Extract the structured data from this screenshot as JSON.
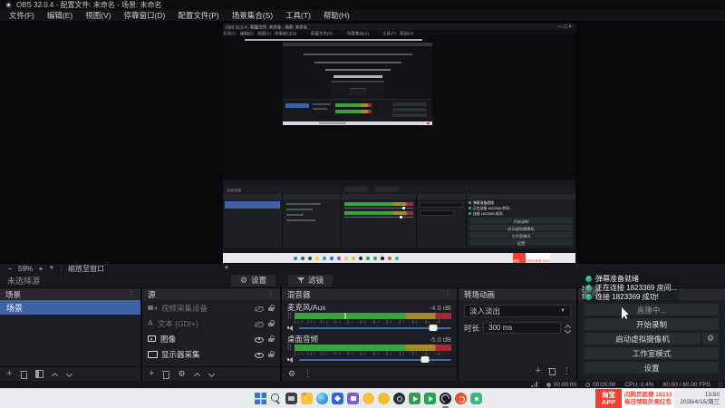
{
  "app": {
    "title": "OBS 32.0.4 - 配置文件: 未命名 - 场景: 未命名",
    "menus": [
      "文件(F)",
      "编辑(E)",
      "视图(V)",
      "停靠窗口(D)",
      "配置文件(P)",
      "场景集合(S)",
      "工具(T)",
      "帮助(H)"
    ],
    "window_buttons": "—  ▢  ✕"
  },
  "preview": {
    "zoom_out": "−",
    "zoom_level": "59%",
    "zoom_in": "+",
    "fit_mode": "缩放至窗口",
    "source_toolbar": {
      "no_source": "未选择源",
      "settings": "设置",
      "filters": "滤镜"
    }
  },
  "docks": {
    "scenes": {
      "title": "场景",
      "items": [
        {
          "label": "场景",
          "selected": true
        }
      ]
    },
    "sources": {
      "title": "源",
      "items": [
        {
          "label": "视频采集设备",
          "icon": "camera",
          "visible": false,
          "locked": true
        },
        {
          "label": "文本 (GDI+)",
          "icon": "text",
          "visible": false,
          "locked": true
        },
        {
          "label": "图像",
          "icon": "image",
          "visible": true,
          "locked": true
        },
        {
          "label": "显示器采集",
          "icon": "display",
          "visible": true,
          "locked": true
        }
      ]
    },
    "mixer": {
      "title": "混音器",
      "ticks": "-60 -55 -50 -45 -40 -35 -30 -25 -20 -15 -10 -5",
      "channels": [
        {
          "label": "麦克风/Aux",
          "db": "-4.0 dB",
          "level_pct": 100,
          "peak_pct": 32,
          "slider_pct": 88
        },
        {
          "label": "桌面音频",
          "db": "-5.0 dB",
          "level_pct": 100,
          "peak_pct": null,
          "slider_pct": 83
        }
      ]
    },
    "transition": {
      "title": "转场动画",
      "selected": "淡入淡出",
      "duration_label": "时长",
      "duration_value": "300 ms"
    },
    "controls": {
      "title": "控件",
      "tooltip": "控制按钮",
      "buttons": [
        {
          "label": "直播中...",
          "disabled": true
        },
        {
          "label": "开始录制",
          "disabled": false
        },
        {
          "label": "启动虚拟摄像机",
          "disabled": false,
          "gear": true
        },
        {
          "label": "工作室模式",
          "disabled": false
        },
        {
          "label": "设置",
          "disabled": false
        }
      ]
    }
  },
  "toasts": [
    {
      "text": "弹幕准备就绪"
    },
    {
      "text": "正在连接 1823369 房间..."
    },
    {
      "text": "连接 1823369 成功!"
    }
  ],
  "statusbar": {
    "stream_time": "00:00:00",
    "record_time": "00:00:00",
    "cpu": "CPU: 0.4%",
    "fps": "60.00 / 60.00 FPS",
    "mini_summary": "CPU: 0.4%  60.00 / 60.00 FPS"
  },
  "taskbar": {
    "icons": [
      {
        "name": "start",
        "type": "start",
        "color": "#3076d6"
      },
      {
        "name": "search",
        "type": "search",
        "color": "#50535a"
      },
      {
        "name": "task-view-app",
        "type": "taskview",
        "color": "#3c4047"
      },
      {
        "name": "file-explorer",
        "type": "folder",
        "color": "#f6c445"
      },
      {
        "name": "edge-browser",
        "type": "edge",
        "color": "#2f9be0"
      },
      {
        "name": "blue-app",
        "type": "photos",
        "color": "#2e66d0"
      },
      {
        "name": "purple-app",
        "type": "store",
        "color": "#8059d8"
      },
      {
        "name": "yellow-app-1",
        "type": "circle",
        "color": "#f3c143"
      },
      {
        "name": "yellow-app-2",
        "type": "circle",
        "color": "#f0b93a"
      },
      {
        "name": "steam-app",
        "type": "steam",
        "color": "#262a33"
      },
      {
        "name": "green-app-1",
        "type": "green",
        "color": "#27a348"
      },
      {
        "name": "green-app-2",
        "type": "green",
        "color": "#27a348"
      },
      {
        "name": "obs-studio",
        "type": "obs",
        "color": "#17191d",
        "active": true
      },
      {
        "name": "orange-app",
        "type": "swirl",
        "color": "#e4512f"
      },
      {
        "name": "mint-app",
        "type": "pill",
        "color": "#3cb878"
      }
    ],
    "banner": {
      "brand_top": "淘宝",
      "brand_bottom": "APP",
      "line1": "闪购页面搜 18233",
      "line2": "每日领取外卖红包"
    },
    "clock": {
      "time": "13:50",
      "date": "2026/4/15/周三"
    }
  },
  "colors": {
    "selection_blue": "#3f62a7",
    "meter_green": "#3aa33c",
    "meter_yellow": "#a58c28",
    "meter_red": "#a82838",
    "slider_blue": "#3d6cb4",
    "toast_green": "#2fae7c",
    "banner_red": "#f83f2e",
    "taskbar_bg": "#e9ebee"
  }
}
